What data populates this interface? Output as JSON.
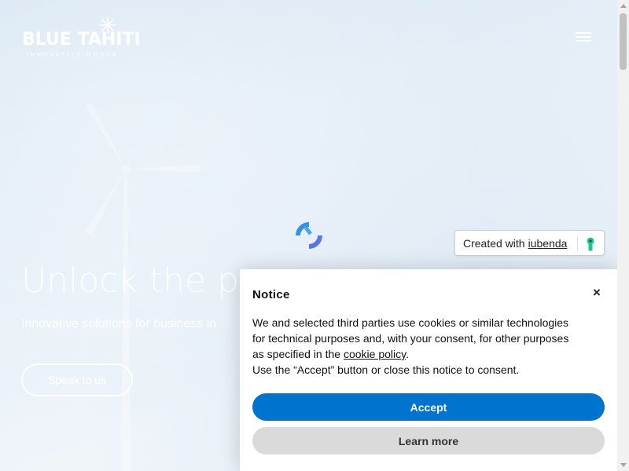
{
  "brand": {
    "logo_text": "BLUE TAHITI",
    "logo_tagline": "INNOVATIVE GROUP"
  },
  "hero": {
    "title": "Unlock the pov",
    "subtitle": "Innovative solutions for business in",
    "cta_label": "Speak to us"
  },
  "iubenda_badge": {
    "prefix": "Created with",
    "link_label": "iubenda"
  },
  "notice": {
    "title": "Notice",
    "close_label": "×",
    "body_part1": "We and selected third parties use cookies or similar technologies for technical purposes and, with your consent, for other purposes as specified in the",
    "cookie_policy_link": "cookie policy",
    "body_part2": ".",
    "body_line2": "Use the “Accept” button or close this notice to consent.",
    "accept_label": "Accept",
    "learn_more_label": "Learn more"
  },
  "colors": {
    "accept_blue": "#0073ce",
    "learn_more_gray": "#dadada",
    "spinner_blue": "#3b8fe0"
  },
  "icons": {
    "menu": "hamburger-icon",
    "close": "close-icon",
    "loading": "spinner-icon",
    "iubenda": "iubenda-keyhole-icon"
  }
}
